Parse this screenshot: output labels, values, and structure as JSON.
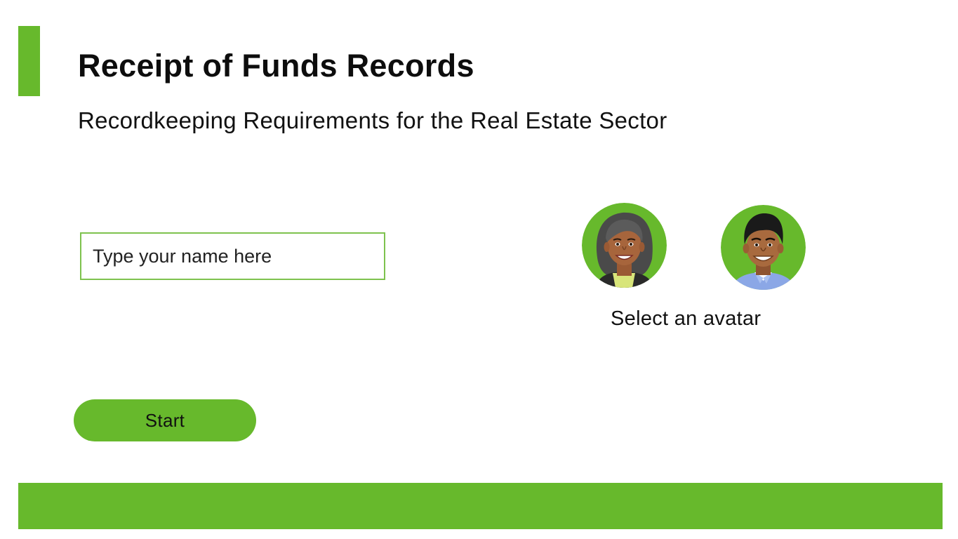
{
  "header": {
    "title": "Receipt of Funds Records",
    "subtitle": "Recordkeeping Requirements for the Real Estate Sector"
  },
  "name_input": {
    "placeholder": "Type your name here",
    "value": ""
  },
  "avatars": {
    "caption": "Select an avatar",
    "options": [
      {
        "name": "female-avatar",
        "icon": "female-avatar-icon"
      },
      {
        "name": "male-avatar",
        "icon": "male-avatar-icon"
      }
    ]
  },
  "actions": {
    "start_label": "Start"
  },
  "colors": {
    "accent": "#67b92c",
    "input_border": "#7ec24e",
    "text": "#111111",
    "background": "#ffffff"
  }
}
